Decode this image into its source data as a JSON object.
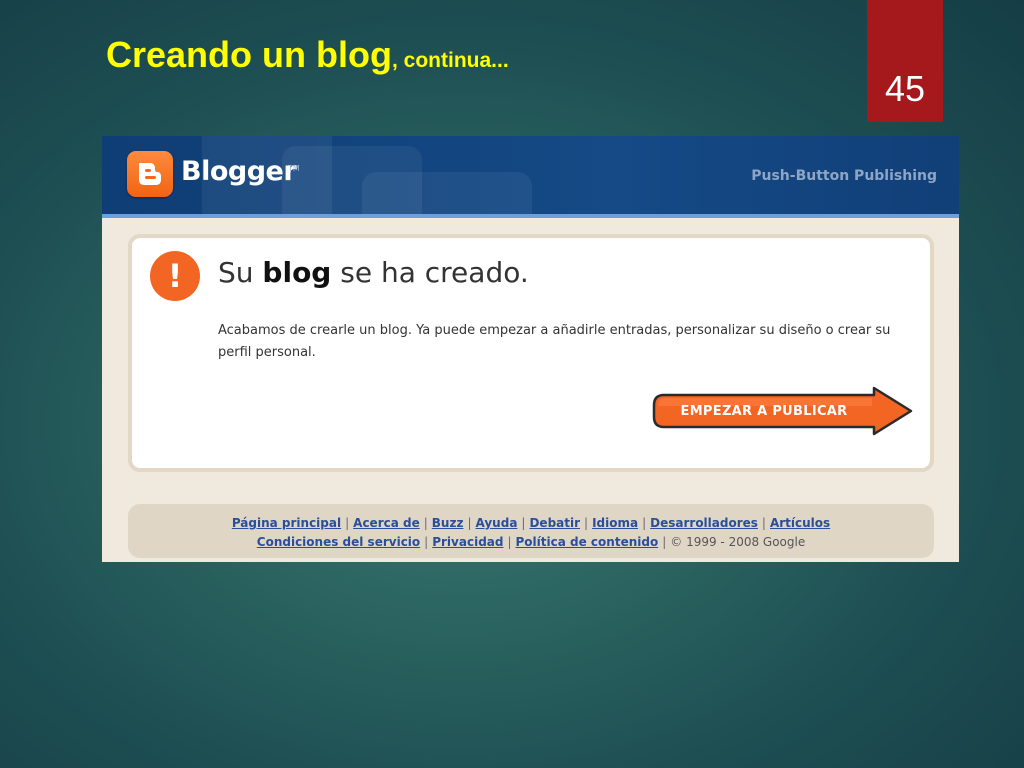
{
  "slide": {
    "title_main": "Creando un blog",
    "title_sub": ", continua...",
    "number": "45"
  },
  "header": {
    "logo_text": "Blogger",
    "logo_tm": "TM",
    "tagline": "Push-Button Publishing"
  },
  "message": {
    "icon_glyph": "!",
    "headline_before": "Su ",
    "headline_bold": "blog",
    "headline_after": " se ha creado.",
    "body": "Acabamos de crearle un blog. Ya puede empezar a añadirle entradas, personalizar su diseño o crear su perfil personal."
  },
  "start_button": {
    "label": "EMPEZAR A PUBLICAR"
  },
  "footer": {
    "row1": [
      "Página principal",
      "Acerca de",
      "Buzz",
      "Ayuda",
      "Debatir",
      "Idioma",
      "Desarrolladores",
      "Artículos"
    ],
    "row2": [
      "Condiciones del servicio",
      "Privacidad",
      "Política de contenido"
    ],
    "separator": "|",
    "copyright": "© 1999 - 2008 Google"
  },
  "colors": {
    "title": "#ffff00",
    "number_box": "#a5181b",
    "header_bg": "#154a86",
    "accent_orange": "#f26522",
    "link": "#2a4f9a"
  },
  "icons": [
    "blogger-logo-icon",
    "alert-icon",
    "arrow-icon"
  ]
}
